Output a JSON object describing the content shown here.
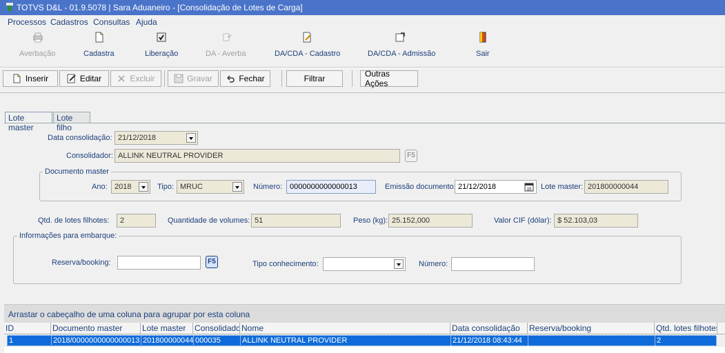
{
  "window": {
    "title": "TOTVS D&L - 01.9.5078 | Sara Aduaneiro - [Consolidação de Lotes de Carga]"
  },
  "menu": [
    "Processos",
    "Cadastros",
    "Consultas",
    "Ajuda"
  ],
  "big_toolbar": [
    {
      "label": "Averbação",
      "icon": "printer-icon",
      "enabled": false
    },
    {
      "label": "Cadastra",
      "icon": "new-document-icon",
      "enabled": true
    },
    {
      "label": "Liberação",
      "icon": "release-stamp-icon",
      "enabled": true
    },
    {
      "label": "DA - Averba",
      "icon": "hand-document-icon",
      "enabled": false
    },
    {
      "label": "DA/CDA - Cadastro",
      "icon": "edit-document-icon",
      "enabled": true
    },
    {
      "label": "DA/CDA - Admissão",
      "icon": "admission-document-icon",
      "enabled": true
    },
    {
      "label": "Sair",
      "icon": "exit-door-icon",
      "enabled": true
    }
  ],
  "actions": {
    "inserir": "Inserir",
    "editar": "Editar",
    "excluir": "Excluir",
    "gravar": "Gravar",
    "fechar": "Fechar",
    "filtrar": "Filtrar",
    "outras": "Outras Ações"
  },
  "tabs": {
    "master": "Lote master",
    "filho": "Lote filho"
  },
  "form": {
    "data_consolidacao_label": "Data consolidação:",
    "data_consolidacao": "21/12/2018",
    "consolidador_label": "Consolidador:",
    "consolidador": "ALLINK NEUTRAL PROVIDER",
    "f5": "F5",
    "documento_master_legend": "Documento master",
    "ano_label": "Ano:",
    "ano": "2018",
    "tipo_label": "Tipo:",
    "tipo": "MRUC",
    "numero_label": "Número:",
    "numero": "0000000000000013",
    "emissao_label": "Emissão documento:",
    "emissao": "21/12/2018",
    "lote_master_label": "Lote master:",
    "lote_master": "201800000044",
    "qtd_lotes_label": "Qtd. de lotes filhotes:",
    "qtd_lotes": "2",
    "qtd_volumes_label": "Quantidade de volumes:",
    "qtd_volumes": "51",
    "peso_label": "Peso (kg):",
    "peso": "25.152,000",
    "valor_cif_label": "Valor CIF (dólar):",
    "valor_cif": "$ 52.103,03",
    "embarque_legend": "Informações para embarque:",
    "reserva_label": "Reserva/booking:",
    "reserva": "",
    "tipo_conhecimento_label": "Tipo conhecimento:",
    "tipo_conhecimento": "",
    "numero2_label": "Número:",
    "numero2": ""
  },
  "grid": {
    "group_hint": "Arrastar o cabeçalho de uma coluna para agrupar por esta coluna",
    "columns": [
      "ID",
      "Documento master",
      "Lote master",
      "Consolidador",
      "Nome",
      "Data consolidação",
      "Reserva/booking",
      "Qtd. lotes filhotes"
    ],
    "rows": [
      [
        "1",
        "2018/0000000000000013",
        "201800000044",
        "000035",
        "ALLINK NEUTRAL PROVIDER",
        "21/12/2018 08:43:44",
        "",
        "2"
      ]
    ]
  },
  "colors": {
    "titlebar": "#4a74c9",
    "selection": "#0f6bd9",
    "label": "#1c3f7a"
  }
}
